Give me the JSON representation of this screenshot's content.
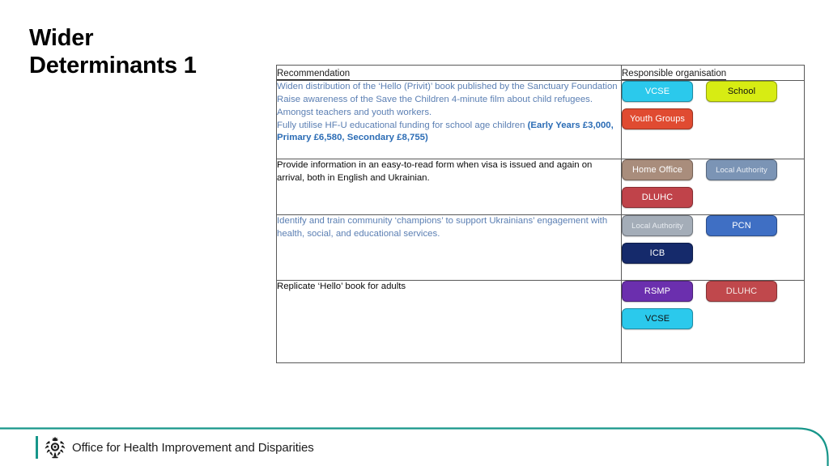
{
  "slide": {
    "title": "Wider\nDeterminants 1"
  },
  "table": {
    "headers": {
      "recommendation": "Recommendation",
      "responsible": "Responsible organisation"
    },
    "rows": [
      {
        "recommendation_lines": [
          {
            "text": "Widen distribution of the ‘Hello (Privit)’ book published by the Sanctuary Foundation",
            "tone": "blue"
          },
          {
            "text": "Raise awareness of the Save the Children  4-minute film about child refugees. Amongst teachers and youth workers.",
            "tone": "blue"
          },
          {
            "text": "Fully utilise HF-U educational funding for school age children ",
            "tone": "blue",
            "suffix": "(Early Years £3,000, Primary £6,580, Secondary £8,755)",
            "suffix_tone": "accent"
          }
        ],
        "organisations": [
          {
            "label": "VCSE",
            "bg": "#2bc9ec",
            "fg": "#ffffff",
            "small": false
          },
          {
            "label": "School",
            "bg": "#d7ec13",
            "fg": "#101010",
            "small": false
          },
          {
            "label": "Youth Groups",
            "bg": "#e04b31",
            "fg": "#ffffff",
            "small": false
          }
        ]
      },
      {
        "recommendation_lines": [
          {
            "text": "Provide information in an easy-to-read form when visa is issued and again on arrival, both in English and Ukrainian.",
            "tone": "black"
          }
        ],
        "organisations": [
          {
            "label": "Home Office",
            "bg": "#a98d7c",
            "fg": "#ffffff",
            "small": false
          },
          {
            "label": "Local Authority",
            "bg": "#7b94b5",
            "fg": "#e9eef5",
            "small": true
          },
          {
            "label": "DLUHC",
            "bg": "#c0434a",
            "fg": "#ffffff",
            "small": false
          }
        ]
      },
      {
        "recommendation_lines": [
          {
            "text": "Identify and train community  ‘champions’ to support Ukrainians’ engagement with health, social, and educational services.",
            "tone": "blue"
          }
        ],
        "organisations": [
          {
            "label": "Local Authority",
            "bg": "#a4adb8",
            "fg": "#e8ecf1",
            "small": true
          },
          {
            "label": "PCN",
            "bg": "#3f6fc4",
            "fg": "#ffffff",
            "small": false
          },
          {
            "label": "ICB",
            "bg": "#152a6b",
            "fg": "#ffffff",
            "small": false
          }
        ]
      },
      {
        "recommendation_lines": [
          {
            "text": "Replicate ‘Hello’ book for adults",
            "tone": "black"
          }
        ],
        "organisations": [
          {
            "label": "RSMP",
            "bg": "#6b2fae",
            "fg": "#ffffff",
            "small": false
          },
          {
            "label": "DLUHC",
            "bg": "#c0484c",
            "fg": "#f4e7e4",
            "small": false
          },
          {
            "label": "VCSE",
            "bg": "#2bc9ec",
            "fg": "#101010",
            "small": false
          }
        ]
      }
    ]
  },
  "footer": {
    "organisation": "Office for Health Improvement and Disparities",
    "accent_color": "#17968a"
  }
}
